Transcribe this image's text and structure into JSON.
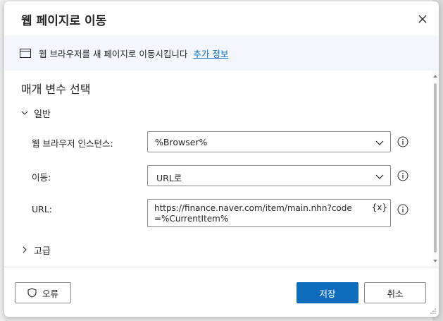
{
  "dialog": {
    "title": "웹 페이지로 이동"
  },
  "info": {
    "text": "웹 브라우저를 새 페이지로 이동시킵니다",
    "link": "추가 정보"
  },
  "parameters": {
    "section_title": "매개 변수 선택",
    "general_group": "일반",
    "advanced_group": "고급",
    "fields": {
      "browser_instance": {
        "label": "웹 브라우저 인스턴스:",
        "value": "%Browser%"
      },
      "navigate": {
        "label": "이동:",
        "value": "URL로"
      },
      "url": {
        "label": "URL:",
        "value": "https://finance.naver.com/item/main.nhn?code=%CurrentItem%",
        "var_button": "{x}"
      }
    }
  },
  "footer": {
    "error_label": "오류",
    "save_label": "저장",
    "cancel_label": "취소"
  },
  "icons": {
    "close": "close-icon",
    "browser": "browser-window-icon",
    "chevron_down": "chevron-down-icon",
    "chevron_right": "chevron-right-icon",
    "help": "info-circle-icon",
    "shield": "shield-icon"
  },
  "colors": {
    "accent": "#0f6cbd",
    "info_bar": "#f3f6fc"
  }
}
